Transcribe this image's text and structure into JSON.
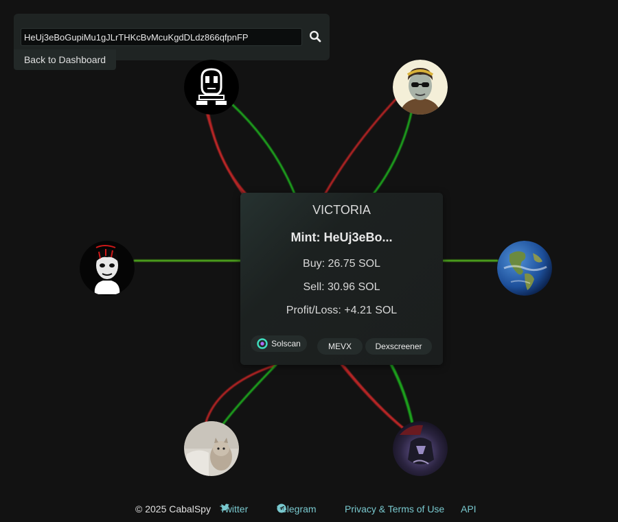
{
  "search": {
    "value": "HeUj3eBoGupiMu1gJLrTHKcBvMcuKgdDLdz866qfpnFP",
    "icon": "search-icon"
  },
  "nav": {
    "back_label": "Back to Dashboard"
  },
  "token": {
    "name": "VICTORIA",
    "mint": "Mint: HeUj3eBo...",
    "buy": "Buy: 26.75 SOL",
    "sell": "Sell: 30.96 SOL",
    "pnl": "Profit/Loss: +4.21 SOL"
  },
  "links": {
    "solscan": "Solscan",
    "mevx": "MEVX",
    "dexscreener": "Dexscreener"
  },
  "wallets": [
    {
      "id": "ghost",
      "avatar": "pixel-ghost-avatar"
    },
    {
      "id": "laurel",
      "avatar": "laurel-sunglasses-avatar"
    },
    {
      "id": "dark",
      "avatar": "dark-portrait-avatar"
    },
    {
      "id": "earth",
      "avatar": "earth-globe-avatar"
    },
    {
      "id": "cat",
      "avatar": "cat-photo-avatar"
    },
    {
      "id": "armor",
      "avatar": "dark-armor-avatar"
    }
  ],
  "colors": {
    "buy_edge": "#1fb81f",
    "sell_edge": "#e03030",
    "link": "#79c9cf"
  },
  "footer": {
    "copyright": "© 2025 CabalSpy",
    "twitter": "Twitter",
    "telegram": "Telegram",
    "privacy": "Privacy & Terms of Use",
    "api": "API"
  }
}
